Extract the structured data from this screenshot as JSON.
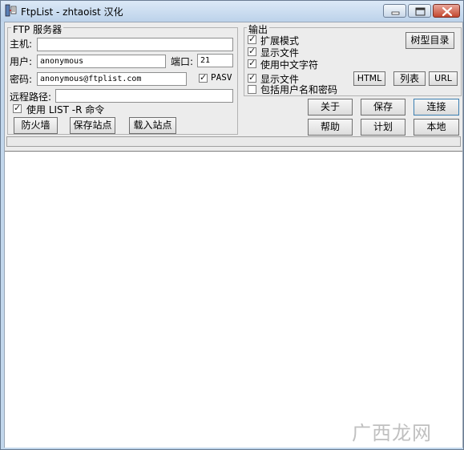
{
  "window": {
    "title": "FtpList - zhtaoist 汉化",
    "controls": [
      "minimize-icon",
      "maximize-icon",
      "close-icon"
    ]
  },
  "server": {
    "legend": "FTP 服务器",
    "host_label": "主机:",
    "host_value": "",
    "user_label": "用户:",
    "user_value": "anonymous",
    "port_label": "端口:",
    "port_value": "21",
    "password_label": "密码:",
    "password_value": "anonymous@ftplist.com",
    "pasv_label": "PASV",
    "pasv_checked": true,
    "remote_path_label": "远程路径:",
    "remote_path_value": "",
    "use_list_r_label": "使用 LIST -R 命令",
    "use_list_r_checked": true,
    "firewall_button": "防火墙",
    "save_site_button": "保存站点",
    "load_site_button": "载入站点"
  },
  "output": {
    "legend": "输出",
    "extended_mode_label": "扩展模式",
    "extended_mode_checked": true,
    "show_files_label": "显示文件",
    "show_files_checked": true,
    "chinese_chars_label": "使用中文字符",
    "chinese_chars_checked": true,
    "show_files2_label": "显示文件",
    "show_files2_checked": true,
    "include_credentials_label": "包括用户名和密码",
    "include_credentials_checked": false,
    "tree_button": "树型目录",
    "html_button": "HTML",
    "list_button": "列表",
    "url_button": "URL"
  },
  "actions": {
    "about_button": "关于",
    "save_button": "保存",
    "connect_button": "连接",
    "help_button": "帮助",
    "schedule_button": "计划",
    "local_button": "本地"
  },
  "status_text": "",
  "watermark_text": "广西龙网"
}
